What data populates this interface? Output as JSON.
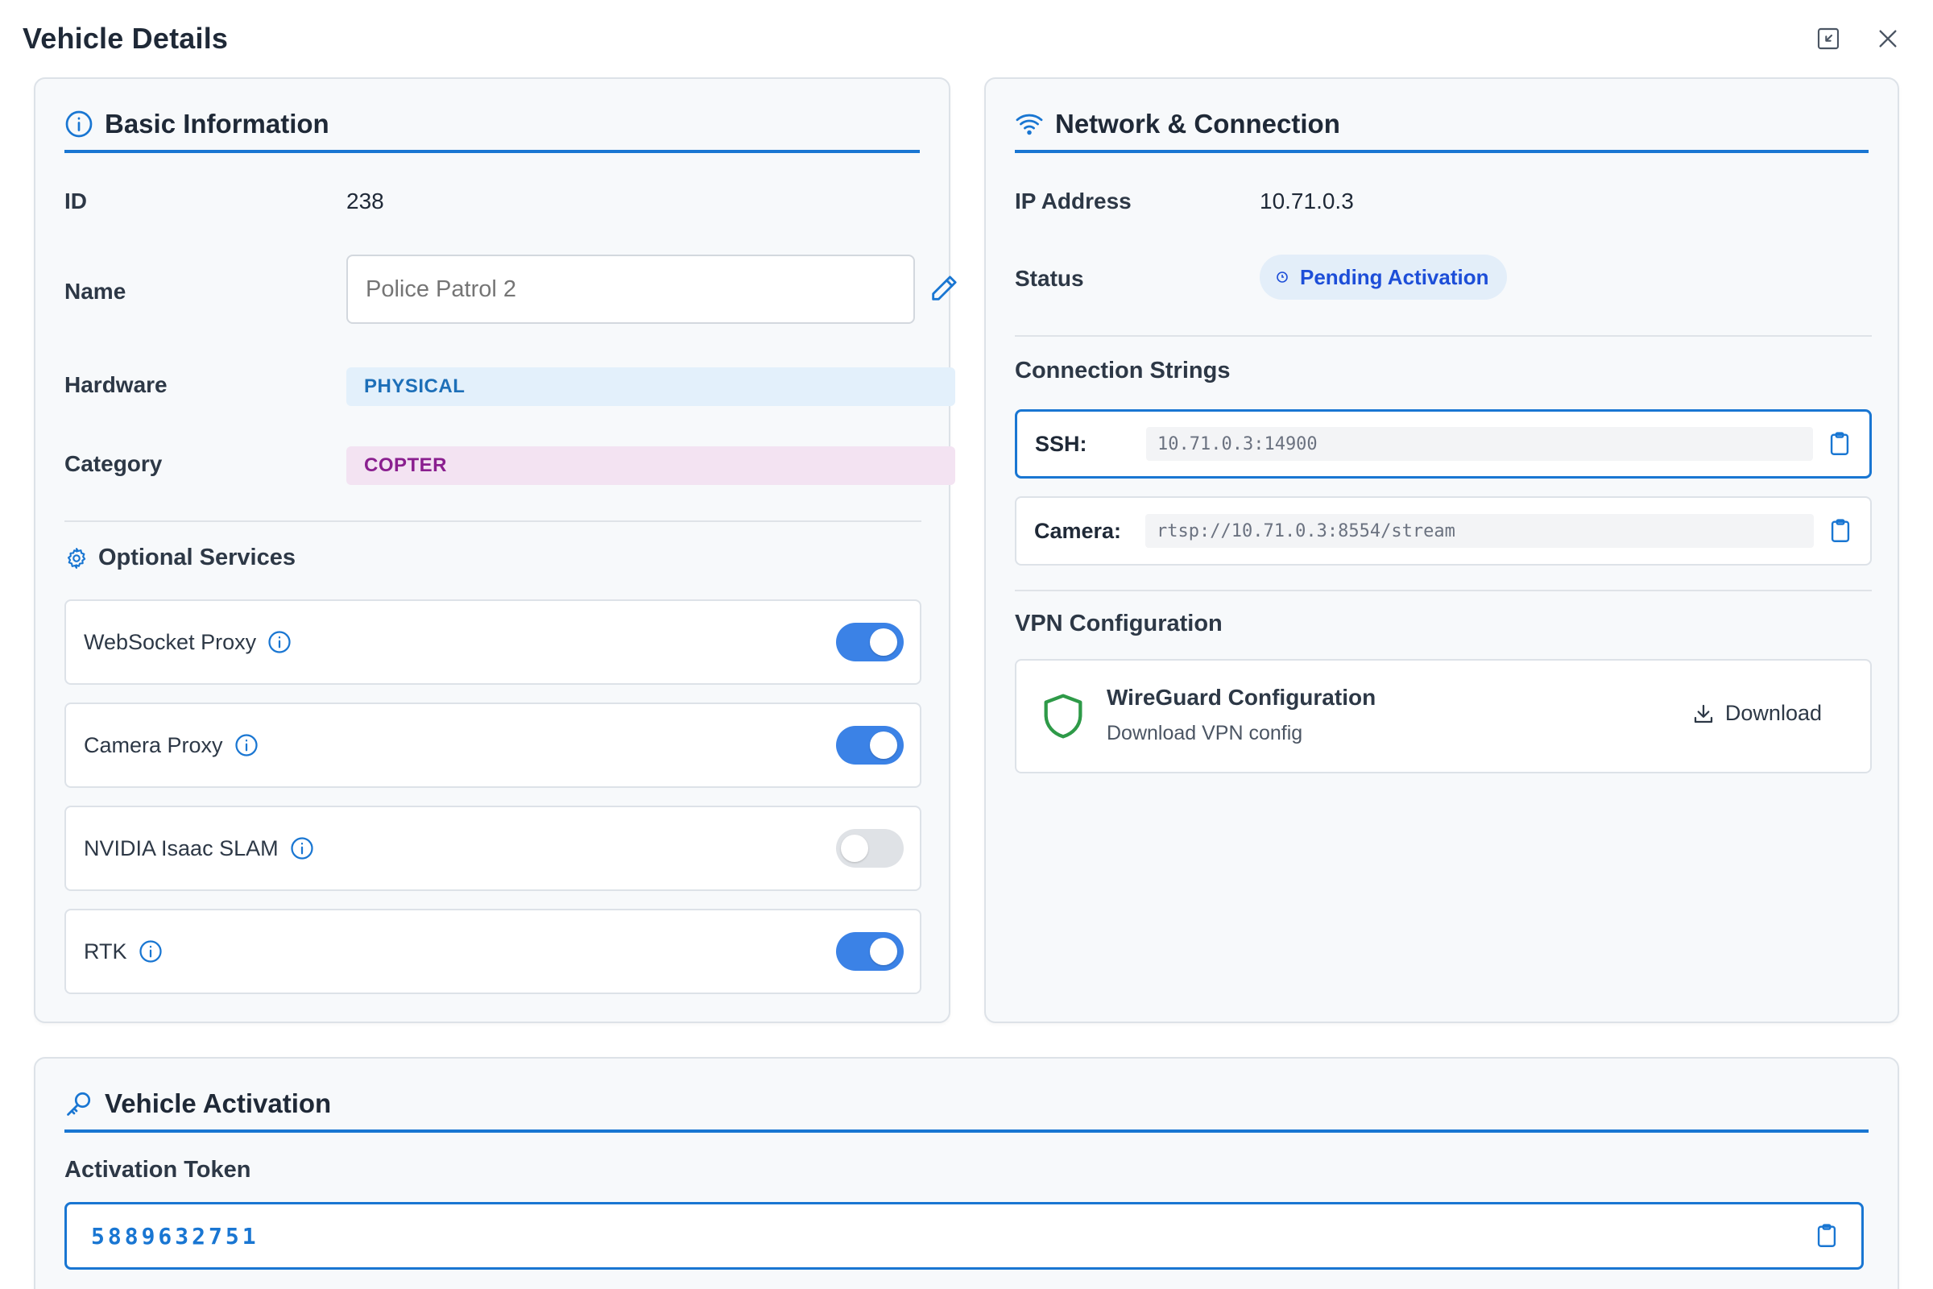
{
  "dialog": {
    "title": "Vehicle Details",
    "icons": {
      "collapse": "collapse-icon",
      "close": "close-icon"
    }
  },
  "basic_info": {
    "title": "Basic Information",
    "icon": "info-icon",
    "id_label": "ID",
    "id_value": "238",
    "name_label": "Name",
    "name_placeholder": "Police Patrol 2",
    "hardware_label": "Hardware",
    "hardware_value": "PHYSICAL",
    "category_label": "Category",
    "category_value": "COPTER",
    "optional_services": {
      "title": "Optional Services",
      "icon": "gear-icon",
      "items": [
        {
          "label": "WebSocket Proxy",
          "enabled": true
        },
        {
          "label": "Camera Proxy",
          "enabled": true
        },
        {
          "label": "NVIDIA Isaac SLAM",
          "enabled": false
        },
        {
          "label": "RTK",
          "enabled": true
        }
      ]
    }
  },
  "network": {
    "title": "Network & Connection",
    "icon": "wifi-icon",
    "ip_label": "IP Address",
    "ip_value": "10.71.0.3",
    "status_label": "Status",
    "status_value": "Pending Activation",
    "connection_strings_title": "Connection Strings",
    "ssh_label": "SSH:",
    "ssh_value": "10.71.0.3:14900",
    "camera_label": "Camera:",
    "camera_value": "rtsp://10.71.0.3:8554/stream",
    "vpn_title": "VPN Configuration",
    "vpn_name": "WireGuard Configuration",
    "vpn_sub": "Download VPN config",
    "download_label": "Download"
  },
  "activation": {
    "title": "Vehicle Activation",
    "icon": "key-icon",
    "token_label": "Activation Token",
    "token_value": "5889632751"
  },
  "colors": {
    "accent": "#1976d2",
    "toggle_on": "#3b82e6",
    "vpn_shield": "#2e9a48"
  }
}
